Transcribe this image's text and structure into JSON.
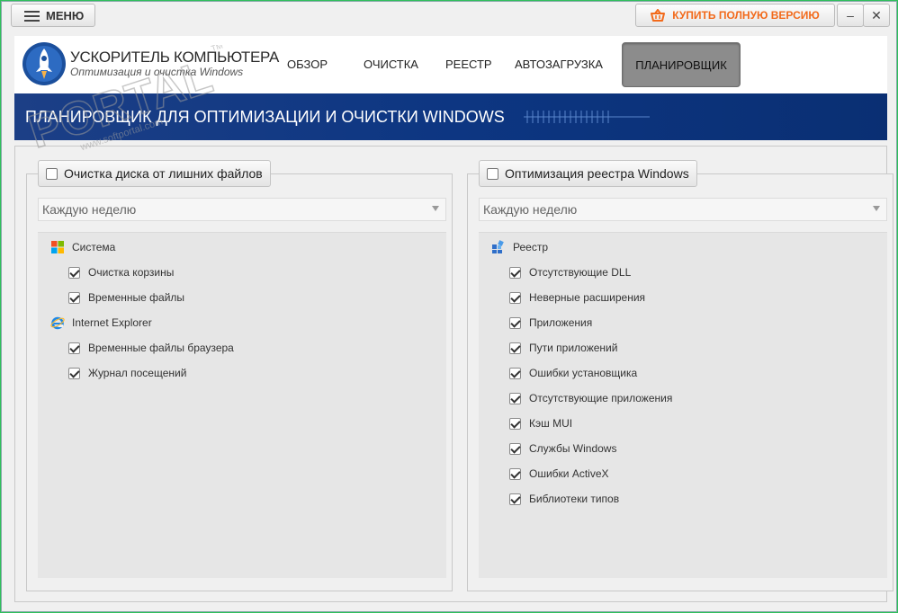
{
  "titlebar": {
    "menu_label": "МЕНЮ",
    "buy_label": "КУПИТЬ ПОЛНУЮ ВЕРСИЮ",
    "minimize_glyph": "–",
    "close_glyph": "✕"
  },
  "header": {
    "brand_title": "УСКОРИТЕЛЬ КОМПЬЮТЕРА",
    "brand_subtitle": "Оптимизация и очистка Windows",
    "tabs": [
      {
        "label": "ОБЗОР"
      },
      {
        "label": "ОЧИСТКА"
      },
      {
        "label": "РЕЕСТР"
      },
      {
        "label": "АВТОЗАГРУЗКА"
      },
      {
        "label": "ПЛАНИРОВЩИК",
        "active": true
      }
    ]
  },
  "banner": {
    "title": "ПЛАНИРОВЩИК ДЛЯ ОПТИМИЗАЦИИ И ОЧИСТКИ WINDOWS"
  },
  "left_group": {
    "header_label": "Очистка диска от лишних файлов",
    "enabled": false,
    "schedule": "Каждую неделю",
    "categories": [
      {
        "label": "Система",
        "icon": "windows-icon",
        "items": [
          {
            "label": "Очистка корзины",
            "checked": true
          },
          {
            "label": "Временные файлы",
            "checked": true
          }
        ]
      },
      {
        "label": "Internet Explorer",
        "icon": "internet-explorer-icon",
        "items": [
          {
            "label": "Временные файлы браузера",
            "checked": true
          },
          {
            "label": "Журнал посещений",
            "checked": true
          }
        ]
      }
    ]
  },
  "right_group": {
    "header_label": "Оптимизация реестра Windows",
    "enabled": false,
    "schedule": "Каждую неделю",
    "categories": [
      {
        "label": "Реестр",
        "icon": "registry-icon",
        "items": [
          {
            "label": "Отсутствующие DLL",
            "checked": true
          },
          {
            "label": "Неверные расширения",
            "checked": true
          },
          {
            "label": "Приложения",
            "checked": true
          },
          {
            "label": "Пути приложений",
            "checked": true
          },
          {
            "label": "Ошибки установщика",
            "checked": true
          },
          {
            "label": "Отсутствующие приложения",
            "checked": true
          },
          {
            "label": "Кэш MUI",
            "checked": true
          },
          {
            "label": "Службы Windows",
            "checked": true
          },
          {
            "label": "Ошибки ActiveX",
            "checked": true
          },
          {
            "label": "Библиотеки типов",
            "checked": true
          }
        ]
      }
    ]
  },
  "watermark": {
    "text": "PORTAL",
    "url": "www.softportal.com",
    "mark": "TM"
  },
  "colors": {
    "accent_orange": "#f26a1b",
    "banner_blue": "#0d3682",
    "active_tab_gray": "#8c8c8c",
    "window_border_green": "#2fbf5a"
  }
}
